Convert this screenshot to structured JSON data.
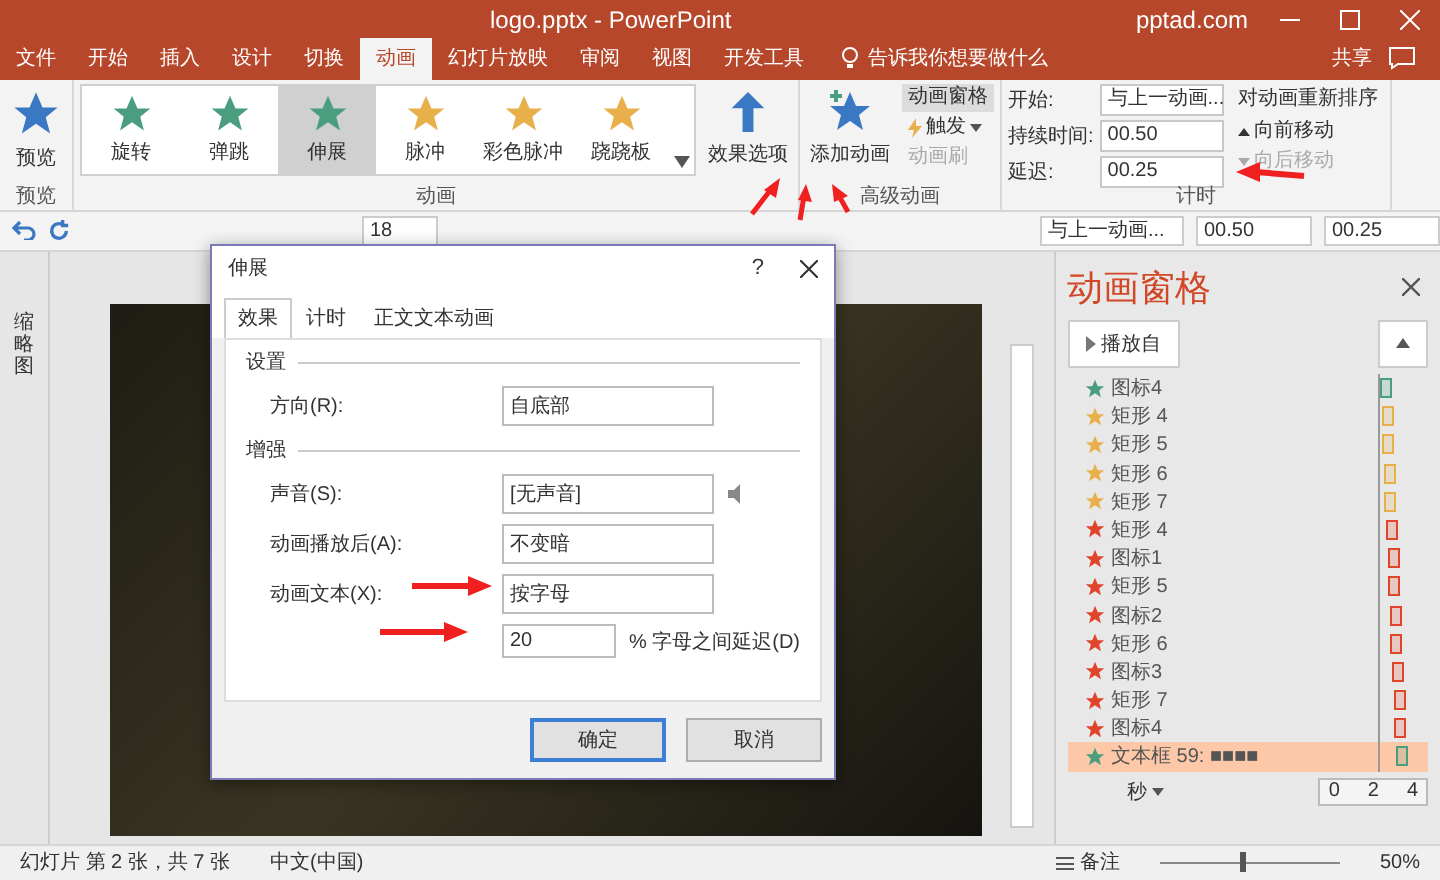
{
  "window": {
    "title": "logo.pptx - PowerPoint",
    "site": "pptad.com"
  },
  "tabs": [
    {
      "label": "文件",
      "selected": false
    },
    {
      "label": "开始",
      "selected": false
    },
    {
      "label": "插入",
      "selected": false
    },
    {
      "label": "设计",
      "selected": false
    },
    {
      "label": "切换",
      "selected": false
    },
    {
      "label": "动画",
      "selected": true
    },
    {
      "label": "幻灯片放映",
      "selected": false
    },
    {
      "label": "审阅",
      "selected": false
    },
    {
      "label": "视图",
      "selected": false
    },
    {
      "label": "开发工具",
      "selected": false
    }
  ],
  "tell_me": "告诉我你想要做什么",
  "share": "共享",
  "ribbon": {
    "preview": "预览",
    "gallery": [
      {
        "label": "旋转",
        "color": "#4a9e7f",
        "selected": false
      },
      {
        "label": "弹跳",
        "color": "#4a9e7f",
        "selected": false
      },
      {
        "label": "伸展",
        "color": "#4a9e7f",
        "selected": true
      },
      {
        "label": "脉冲",
        "color": "#e8b04a",
        "selected": false
      },
      {
        "label": "彩色脉冲",
        "color": "#e8b04a",
        "selected": false
      },
      {
        "label": "跷跷板",
        "color": "#e8b04a",
        "selected": false
      }
    ],
    "effect_options": "效果选项",
    "add_animation": "添加动画",
    "animation_pane": "动画窗格",
    "trigger": "触发",
    "painter": {
      "label": "动画刷",
      "disabled": true
    },
    "start_label": "开始:",
    "start_value": "与上一动画...",
    "duration_label": "持续时间:",
    "duration": "00.50",
    "delay_label": "延迟:",
    "delay": "00.25",
    "reorder": "对动画重新排序",
    "move_earlier": {
      "label": "向前移动",
      "disabled": false
    },
    "move_later": {
      "label": "向后移动",
      "disabled": true
    },
    "groups": [
      "预览",
      "动画",
      "高级动画",
      "计时"
    ]
  },
  "toolbar": {
    "font_size": "18",
    "start": "与上一动画...",
    "duration": "00.50",
    "delay": "00.25"
  },
  "thumbnails_label": "缩略图",
  "dialog": {
    "title": "伸展",
    "help": "?",
    "tabs": [
      {
        "label": "效果",
        "selected": true
      },
      {
        "label": "计时",
        "selected": false
      },
      {
        "label": "正文文本动画",
        "selected": false
      }
    ],
    "settings_heading": "设置",
    "direction_label": "方向(R):",
    "direction": "自底部",
    "enhance_heading": "增强",
    "sound_label": "声音(S):",
    "sound": "[无声音]",
    "after_label": "动画播放后(A):",
    "after": "不变暗",
    "text_label": "动画文本(X):",
    "text": "按字母",
    "delay_value": "20",
    "delay_label": "% 字母之间延迟(D)",
    "ok": "确定",
    "cancel": "取消"
  },
  "pane": {
    "title": "动画窗格",
    "play_from": "播放自",
    "items": [
      {
        "label": "图标4",
        "color": "#4a9e7f",
        "selected": false
      },
      {
        "label": "矩形 4",
        "color": "#e8b04a",
        "selected": false
      },
      {
        "label": "矩形 5",
        "color": "#e8b04a",
        "selected": false
      },
      {
        "label": "矩形 6",
        "color": "#e8b04a",
        "selected": false
      },
      {
        "label": "矩形 7",
        "color": "#e8b04a",
        "selected": false
      },
      {
        "label": "矩形 4",
        "color": "#e0442a",
        "selected": false
      },
      {
        "label": "图标1",
        "color": "#e0442a",
        "selected": false
      },
      {
        "label": "矩形 5",
        "color": "#e0442a",
        "selected": false
      },
      {
        "label": "图标2",
        "color": "#e0442a",
        "selected": false
      },
      {
        "label": "矩形 6",
        "color": "#e0442a",
        "selected": false
      },
      {
        "label": "图标3",
        "color": "#e0442a",
        "selected": false
      },
      {
        "label": "矩形 7",
        "color": "#e0442a",
        "selected": false
      },
      {
        "label": "图标4",
        "color": "#e0442a",
        "selected": false
      },
      {
        "label": "文本框 59: ■■■■",
        "color": "#4a9e7f",
        "selected": true
      }
    ],
    "seconds": "秒",
    "ticks": [
      "0",
      "2",
      "4"
    ]
  },
  "status": {
    "slide": "幻灯片 第 2 张，共 7 张",
    "language": "中文(中国)",
    "notes": "备注",
    "zoom": "50%",
    "zoom_slider": {
      "level": 0.45
    }
  }
}
